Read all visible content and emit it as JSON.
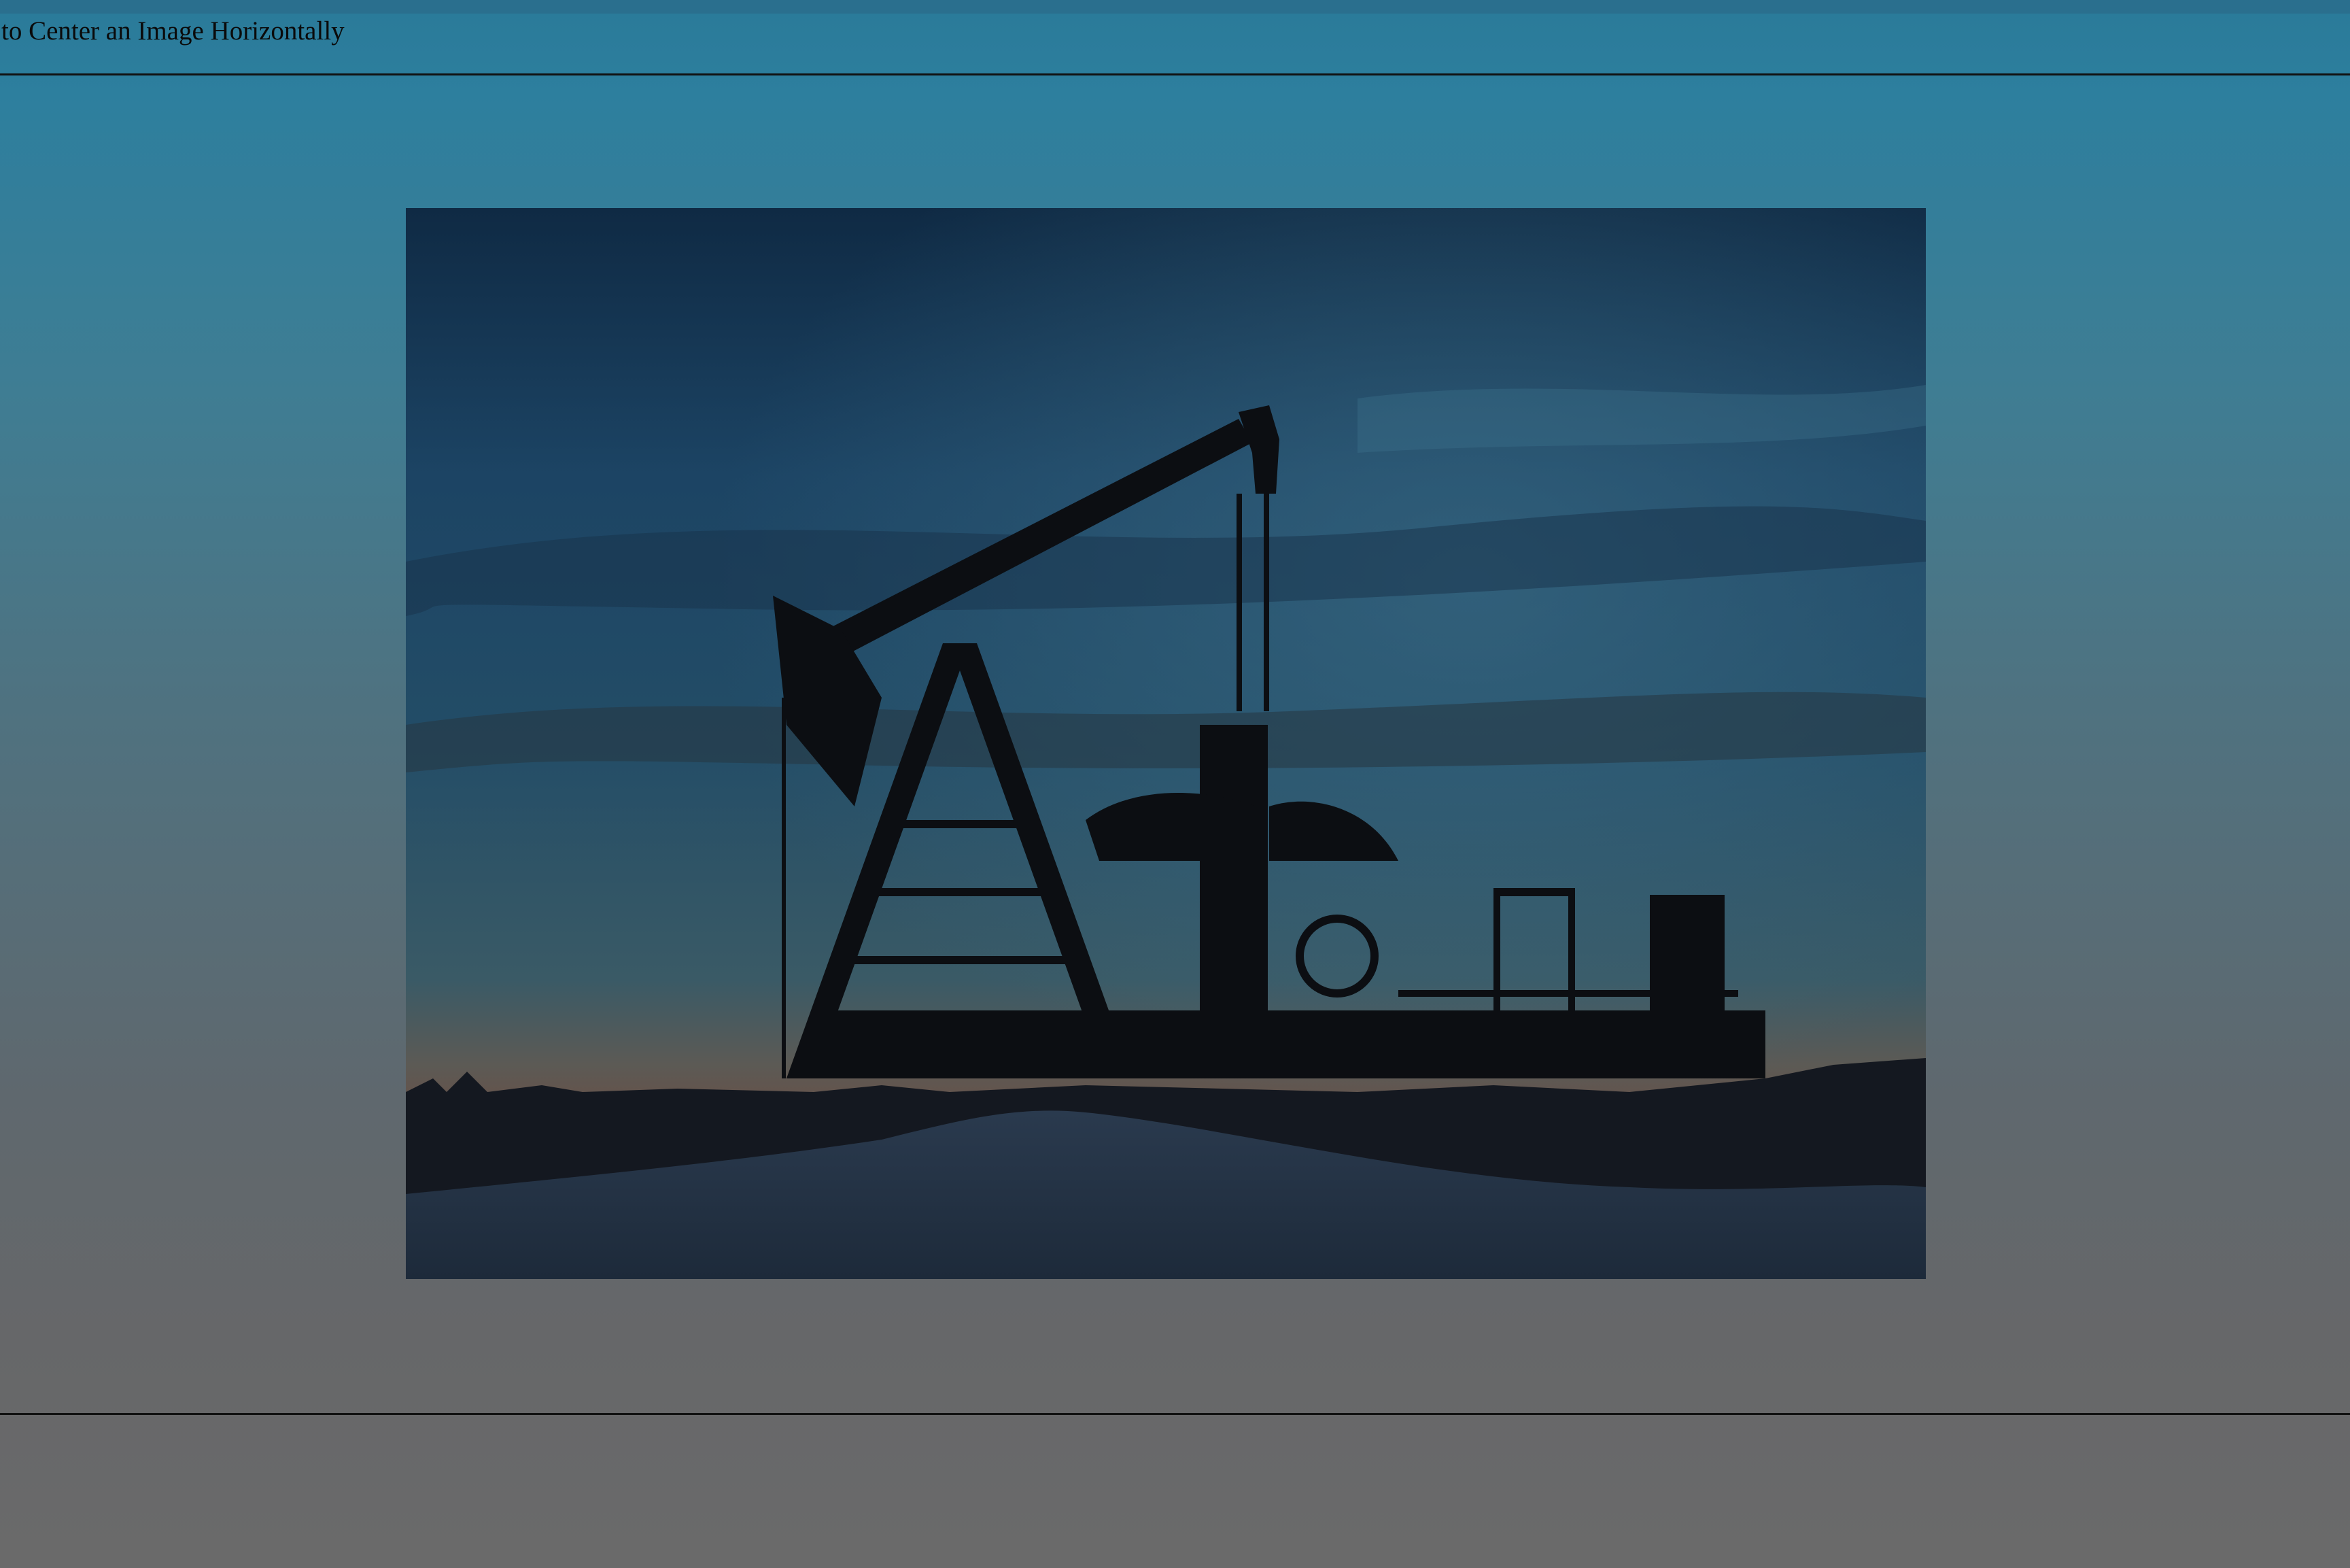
{
  "page": {
    "title": "to Center an Image Horizontally"
  },
  "image": {
    "subject": "oil pump jack silhouette at dusk",
    "icon": "photo-icon"
  },
  "colors": {
    "background_top": "#2a7a99",
    "background_bottom": "#6a6a6a",
    "rule": "#111111",
    "title_text": "#0a0a0a"
  }
}
